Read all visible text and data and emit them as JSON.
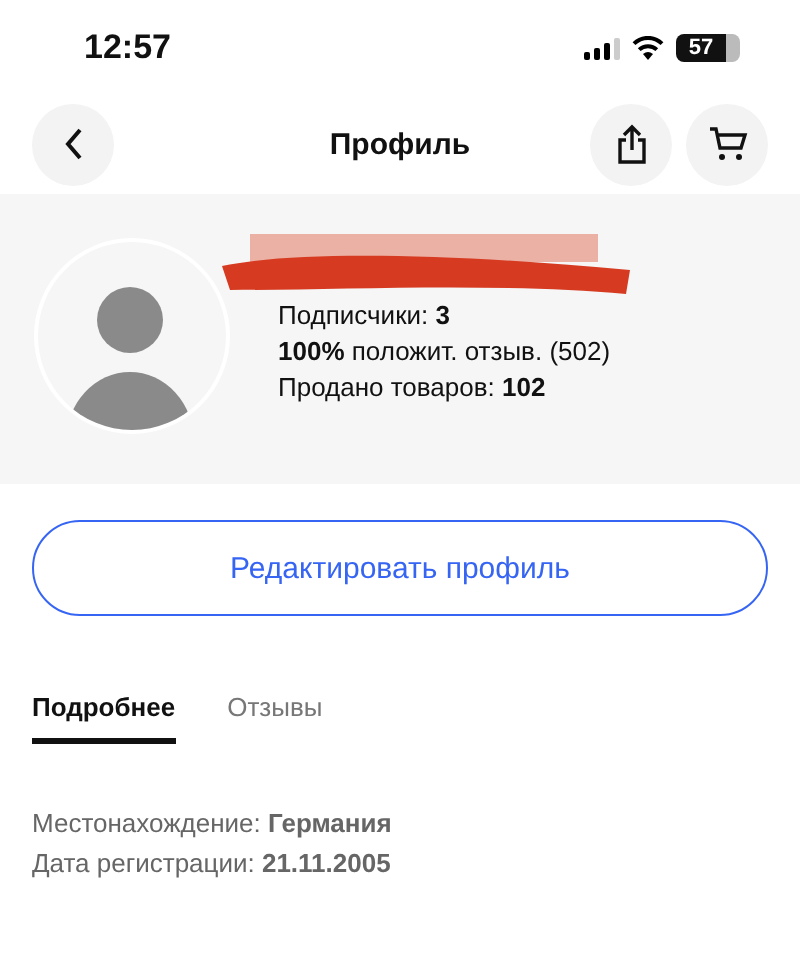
{
  "status_bar": {
    "time": "12:57",
    "battery": "57"
  },
  "header": {
    "title": "Профиль"
  },
  "profile": {
    "stats": [
      "Подписчики: **3**",
      "**100%** положит. отзыв. (502)",
      "Продано товаров: **102**"
    ]
  },
  "edit_button": "Редактировать профиль",
  "tabs": [
    {
      "label": "Подробнее",
      "selected": true
    },
    {
      "label": "Отзывы",
      "selected": false
    }
  ],
  "details": [
    "Местонахождение: **Германия**",
    "Дата регистрации: **21.11.2005**"
  ]
}
